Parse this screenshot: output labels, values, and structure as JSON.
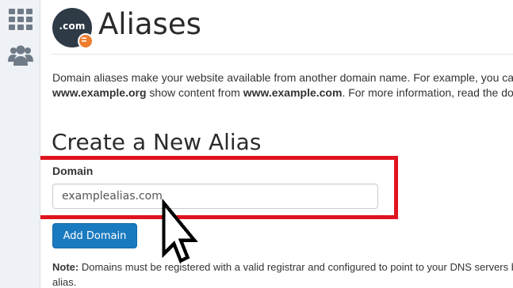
{
  "page": {
    "title": "Aliases",
    "header_icon_text": ".com"
  },
  "sidebar": {
    "icons": [
      "apps-grid-icon",
      "users-group-icon"
    ]
  },
  "description": {
    "line1": "Domain aliases make your website available from another domain name. For example, you can make",
    "line2_domain1": "www.example.org",
    "line2_middle": " show content from ",
    "line2_domain2": "www.example.com",
    "line2_end": ". For more information, read the documentation."
  },
  "form": {
    "section_title": "Create a New Alias",
    "domain_label": "Domain",
    "domain_value": "examplealias.com",
    "submit_label": "Add Domain"
  },
  "note": {
    "label": "Note:",
    "line1": " Domains must be registered with a valid registrar and configured to point to your DNS servers before you can use them as an",
    "line2": "alias."
  },
  "colors": {
    "highlight": "#e0141e",
    "button": "#1a7ac0",
    "badge": "#ef7d2e",
    "icon_bg": "#2e3a46"
  }
}
